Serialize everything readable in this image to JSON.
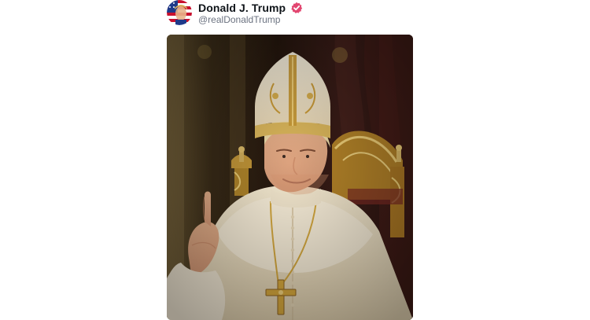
{
  "post": {
    "author": {
      "display_name": "Donald J. Trump",
      "handle": "@realDonaldTrump",
      "avatar_icon": "avatar-flag-portrait",
      "verified_icon": "verified-check-icon",
      "verified_color": "#e24670"
    },
    "media": {
      "kind": "image",
      "subject_icon": "pope-portrait-image"
    }
  },
  "colors": {
    "text_primary": "#0f1419",
    "text_secondary": "#6b7280",
    "background": "#ffffff"
  }
}
